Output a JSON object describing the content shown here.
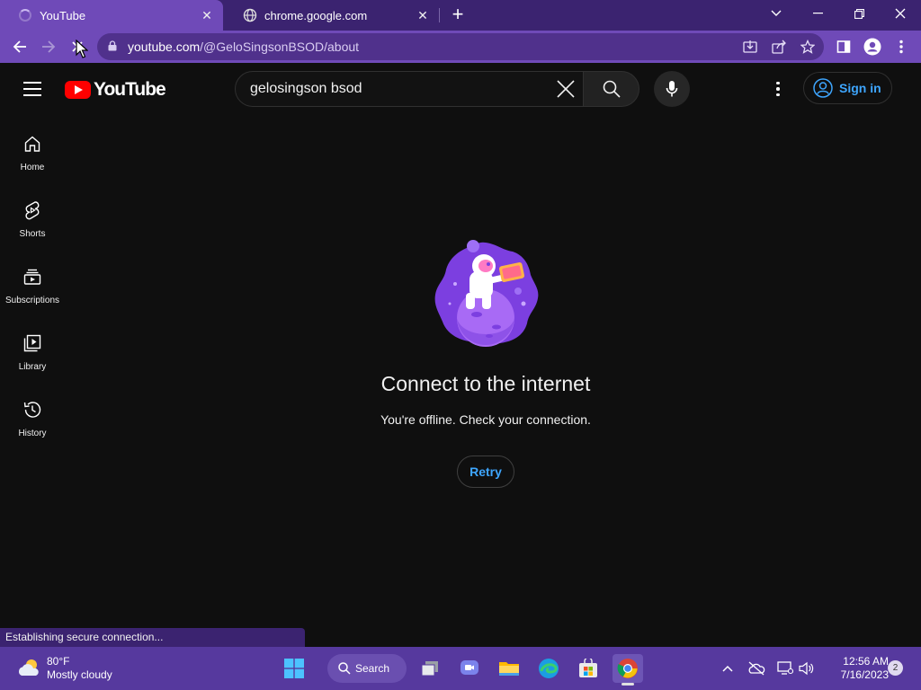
{
  "browser": {
    "tabs": [
      {
        "title": "YouTube",
        "state": "loading"
      },
      {
        "title": "chrome.google.com",
        "state": "idle"
      }
    ],
    "url_host": "youtube.com",
    "url_path": "/@GeloSingsonBSOD/about"
  },
  "youtube": {
    "logo_text": "YouTube",
    "search_query": "gelosingson bsod",
    "signin_label": "Sign in",
    "sidebar": [
      {
        "label": "Home",
        "icon": "home-icon"
      },
      {
        "label": "Shorts",
        "icon": "shorts-icon"
      },
      {
        "label": "Subscriptions",
        "icon": "subscriptions-icon"
      },
      {
        "label": "Library",
        "icon": "library-icon"
      },
      {
        "label": "History",
        "icon": "history-icon"
      }
    ],
    "offline": {
      "title": "Connect to the internet",
      "message": "You're offline. Check your connection.",
      "retry_label": "Retry"
    }
  },
  "status_bar": "Establishing secure connection...",
  "taskbar": {
    "weather_temp": "80°F",
    "weather_desc": "Mostly cloudy",
    "search_label": "Search",
    "time": "12:56 AM",
    "date": "7/16/2023",
    "notification_count": "2"
  },
  "colors": {
    "frame": "#6f4ab8",
    "tabstrip": "#3b2370",
    "taskbar": "#56399e",
    "yt_red": "#ff0000",
    "link_blue": "#3ea6ff"
  }
}
